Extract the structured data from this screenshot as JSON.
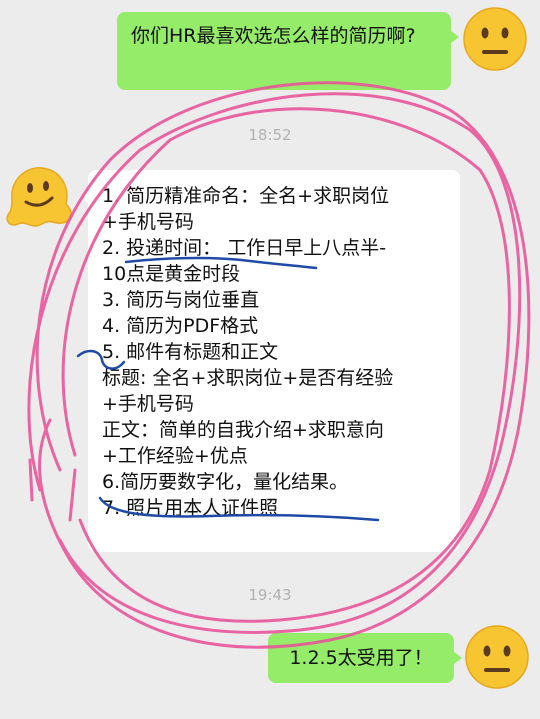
{
  "messages": {
    "question": "你们HR最喜欢选怎么样的简历啊?",
    "time1": "18:52",
    "list": [
      "1. 简历精准命名：全名+求职岗位",
      "+手机号码",
      "2. 投递时间：  工作日早上八点半-",
      "10点是黄金时段",
      "3. 简历与岗位垂直",
      "4. 简历为PDF格式",
      "5. 邮件有标题和正文",
      "标题: 全名+求职岗位+是否有经验",
      "+手机号码",
      "正文：简单的自我介绍+求职意向",
      "+工作经验+优点",
      "6.简历要数字化，量化结果。",
      "7. 照片用本人证件照"
    ],
    "time2": "19:43",
    "reply": "1.2.5太受用了！"
  },
  "icons": {
    "neutral_face": "neutral-face-emoji",
    "melting_face": "melting-face-emoji"
  },
  "colors": {
    "my_bubble": "#95ec69",
    "their_bubble": "#ffffff",
    "pink_scribble": "#e8569a",
    "blue_underline": "#1f4aa8"
  }
}
